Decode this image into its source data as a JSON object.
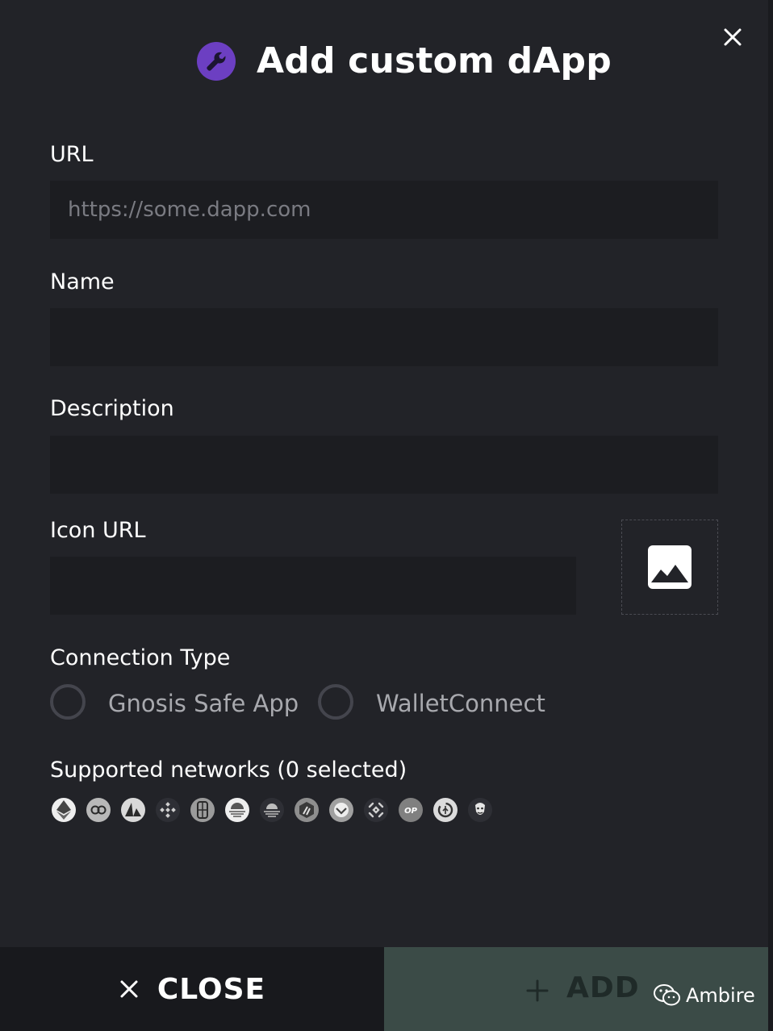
{
  "header": {
    "title": "Add custom dApp",
    "icon": "wrench-icon",
    "icon_bg": "#6c3fc2"
  },
  "form": {
    "url": {
      "label": "URL",
      "placeholder": "https://some.dapp.com",
      "value": ""
    },
    "name": {
      "label": "Name",
      "value": ""
    },
    "description": {
      "label": "Description",
      "value": ""
    },
    "icon_url": {
      "label": "Icon URL",
      "value": "",
      "preview_icon": "image-placeholder-icon"
    }
  },
  "connection_type": {
    "label": "Connection Type",
    "options": [
      {
        "label": "Gnosis Safe App",
        "selected": false
      },
      {
        "label": "WalletConnect",
        "selected": false
      }
    ]
  },
  "networks": {
    "label": "Supported networks (0 selected)",
    "items": [
      {
        "icon": "ethereum-icon"
      },
      {
        "icon": "polygon-icon"
      },
      {
        "icon": "avalanche-icon"
      },
      {
        "icon": "bnb-chain-icon"
      },
      {
        "icon": "fantom-icon"
      },
      {
        "icon": "moonbeam-icon"
      },
      {
        "icon": "moonriver-icon"
      },
      {
        "icon": "arbitrum-icon"
      },
      {
        "icon": "gnosis-icon"
      },
      {
        "icon": "kucoin-icon"
      },
      {
        "icon": "optimism-icon"
      },
      {
        "icon": "andromeda-icon"
      },
      {
        "icon": "cronos-icon"
      }
    ]
  },
  "footer": {
    "close_label": "CLOSE",
    "add_label": "ADD",
    "add_bg": "#3b4b47",
    "watermark": "Ambire"
  }
}
